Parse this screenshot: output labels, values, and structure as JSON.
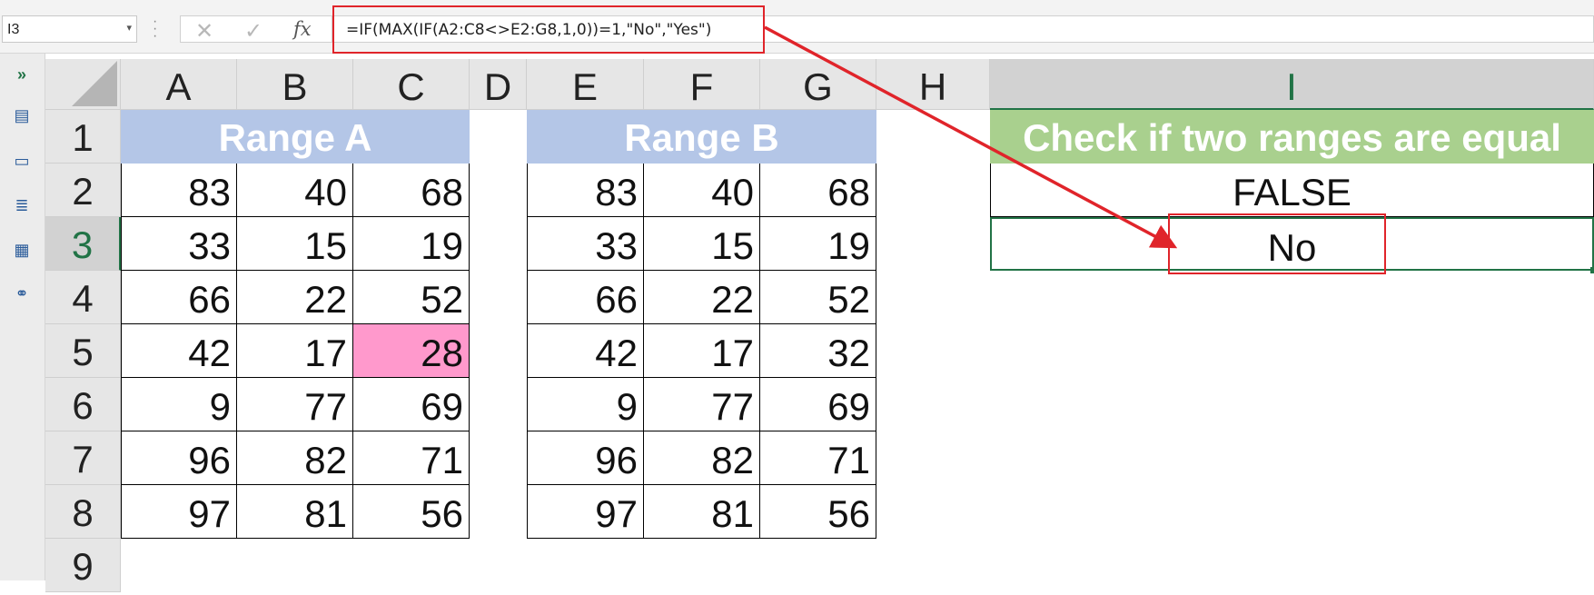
{
  "formula_bar": {
    "name_box": "I3",
    "formula": "=IF(MAX(IF(A2:C8<>E2:G8,1,0))=1,\"No\",\"Yes\")",
    "fx_label": "fx"
  },
  "columns": [
    "A",
    "B",
    "C",
    "D",
    "E",
    "F",
    "G",
    "H",
    "I"
  ],
  "rows": [
    "1",
    "2",
    "3",
    "4",
    "5",
    "6",
    "7",
    "8",
    "9"
  ],
  "range_a": {
    "title": "Range A",
    "values": [
      [
        "83",
        "40",
        "68"
      ],
      [
        "33",
        "15",
        "19"
      ],
      [
        "66",
        "22",
        "52"
      ],
      [
        "42",
        "17",
        "28"
      ],
      [
        "9",
        "77",
        "69"
      ],
      [
        "96",
        "82",
        "71"
      ],
      [
        "97",
        "81",
        "56"
      ]
    ]
  },
  "range_b": {
    "title": "Range B",
    "values": [
      [
        "83",
        "40",
        "68"
      ],
      [
        "33",
        "15",
        "19"
      ],
      [
        "66",
        "22",
        "52"
      ],
      [
        "42",
        "17",
        "32"
      ],
      [
        "9",
        "77",
        "69"
      ],
      [
        "96",
        "82",
        "71"
      ],
      [
        "97",
        "81",
        "56"
      ]
    ]
  },
  "check": {
    "title": "Check if two ranges are equal",
    "row2": "FALSE",
    "row3": "No"
  },
  "colors": {
    "range_header": "#b4c6e7",
    "check_header": "#a9d08e",
    "diff_highlight": "#ff99cc",
    "annotation": "#e0242a",
    "selection": "#217346"
  },
  "left_panel_icons": [
    "expand-icon",
    "table-icon",
    "form-icon",
    "layers-icon",
    "grid-icon",
    "find-icon"
  ]
}
